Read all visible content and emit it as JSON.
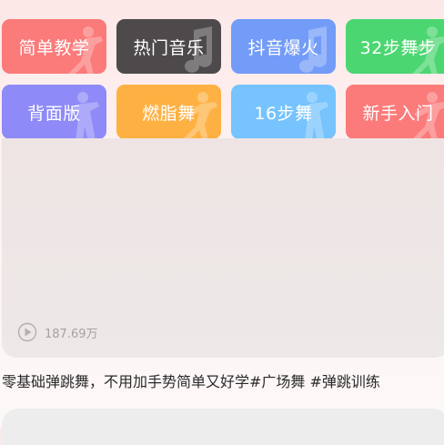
{
  "categories": [
    {
      "label": "简单教学",
      "color": "#fb7a7a",
      "icon": "dancer-icon"
    },
    {
      "label": "热门音乐",
      "color": "#4e4a4b",
      "icon": "music-note-icon"
    },
    {
      "label": "抖音爆火",
      "color": "#739cf8",
      "icon": "music-note-icon"
    },
    {
      "label": "32步舞步",
      "color": "#4cd671",
      "icon": "dancer-icon"
    },
    {
      "label": "背面版",
      "color": "#8e8af7",
      "icon": "dancer-icon"
    },
    {
      "label": "燃脂舞",
      "color": "#feb143",
      "icon": "dancer-icon"
    },
    {
      "label": "16步舞",
      "color": "#76c3fd",
      "icon": "dancer-icon"
    },
    {
      "label": "新手入门",
      "color": "#fb7a7a",
      "icon": "dancer-icon"
    }
  ],
  "video": {
    "play_count": "187.69万",
    "title": "零基础弹跳舞，不用加手势简单又好学#广场舞 #弹跳训练"
  }
}
